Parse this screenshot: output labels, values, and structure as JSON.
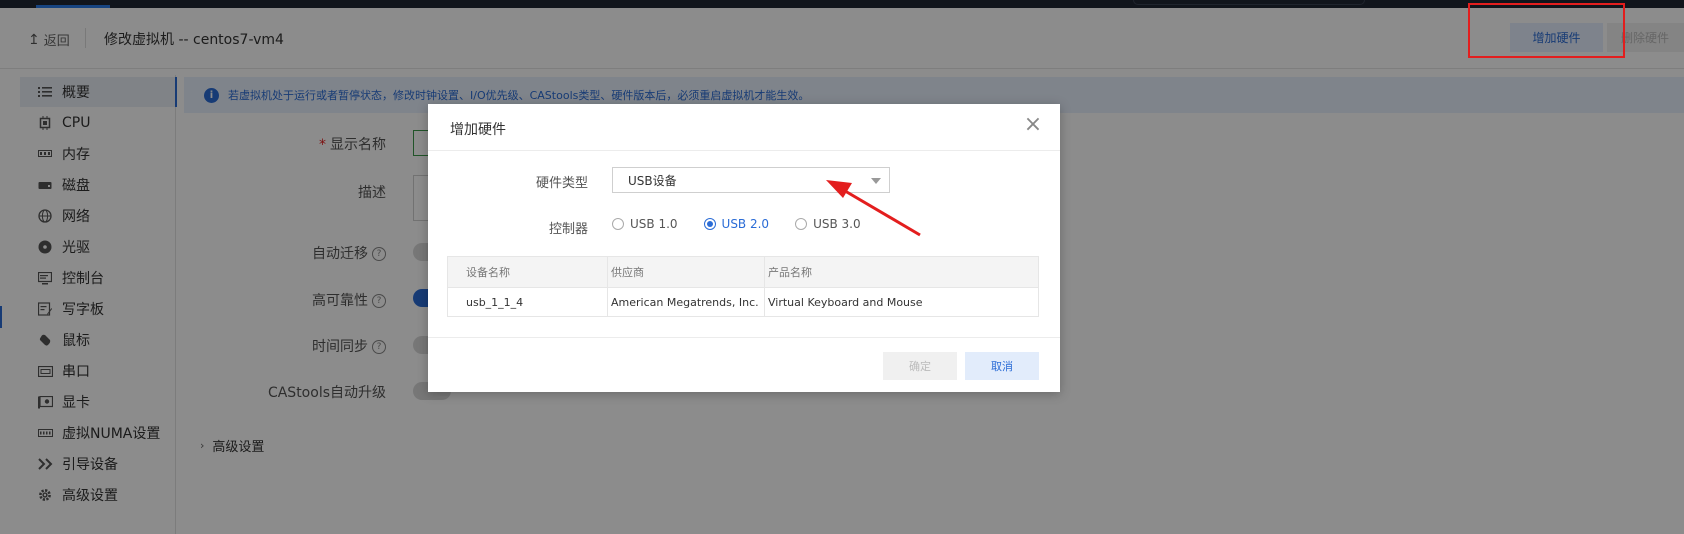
{
  "header": {
    "back_label": "返回",
    "title": "修改虚拟机 -- centos7-vm4",
    "add_hardware": "增加硬件",
    "remove_hardware": "删除硬件"
  },
  "sidebar": {
    "items": [
      {
        "label": "概要",
        "icon": "list-icon"
      },
      {
        "label": "CPU",
        "icon": "cpu-icon"
      },
      {
        "label": "内存",
        "icon": "memory-icon"
      },
      {
        "label": "磁盘",
        "icon": "disk-icon"
      },
      {
        "label": "网络",
        "icon": "globe-icon"
      },
      {
        "label": "光驱",
        "icon": "cdrom-icon"
      },
      {
        "label": "控制台",
        "icon": "console-icon"
      },
      {
        "label": "写字板",
        "icon": "tablet-icon"
      },
      {
        "label": "鼠标",
        "icon": "mouse-icon"
      },
      {
        "label": "串口",
        "icon": "serial-port-icon"
      },
      {
        "label": "显卡",
        "icon": "graphics-card-icon"
      },
      {
        "label": "虚拟NUMA设置",
        "icon": "numa-icon"
      },
      {
        "label": "引导设备",
        "icon": "boot-icon"
      },
      {
        "label": "高级设置",
        "icon": "gear-icon"
      }
    ]
  },
  "main": {
    "banner": "若虚拟机处于运行或者暂停状态，修改时钟设置、I/O优先级、CAStools类型、硬件版本后，必须重启虚拟机才能生效。",
    "fields": {
      "display_name": "显示名称",
      "description": "描述",
      "auto_migrate": "自动迁移",
      "high_availability": "高可靠性",
      "time_sync": "时间同步",
      "castools_upgrade": "CAStools自动升级"
    },
    "advanced": "高级设置"
  },
  "dialog": {
    "title": "增加硬件",
    "hw_type_label": "硬件类型",
    "hw_type_value": "USB设备",
    "controller_label": "控制器",
    "controllers": [
      {
        "label": "USB 1.0",
        "checked": false
      },
      {
        "label": "USB 2.0",
        "checked": true
      },
      {
        "label": "USB 3.0",
        "checked": false
      }
    ],
    "table": {
      "headers": [
        "设备名称",
        "供应商",
        "产品名称"
      ],
      "rows": [
        [
          "usb_1_1_4",
          "American Megatrends, Inc.",
          "Virtual Keyboard and Mouse"
        ]
      ]
    },
    "ok": "确定",
    "cancel": "取消"
  },
  "colors": {
    "accent": "#2b6cd6",
    "annotation": "#e31e1e"
  }
}
